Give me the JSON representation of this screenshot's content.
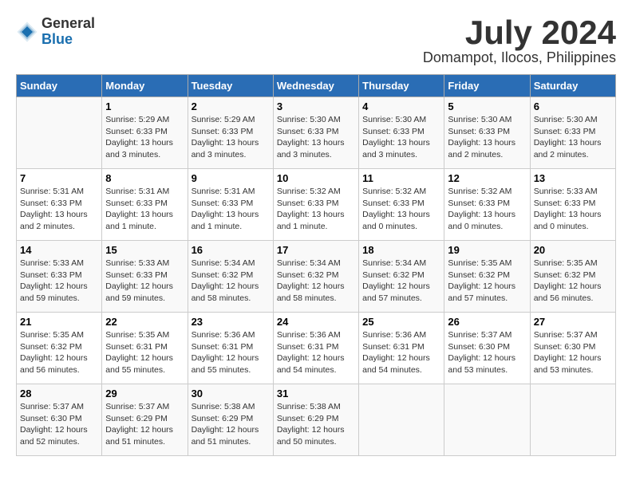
{
  "logo": {
    "general": "General",
    "blue": "Blue"
  },
  "title": "July 2024",
  "subtitle": "Domampot, Ilocos, Philippines",
  "calendar": {
    "headers": [
      "Sunday",
      "Monday",
      "Tuesday",
      "Wednesday",
      "Thursday",
      "Friday",
      "Saturday"
    ],
    "weeks": [
      [
        {
          "day": "",
          "info": ""
        },
        {
          "day": "1",
          "info": "Sunrise: 5:29 AM\nSunset: 6:33 PM\nDaylight: 13 hours\nand 3 minutes."
        },
        {
          "day": "2",
          "info": "Sunrise: 5:29 AM\nSunset: 6:33 PM\nDaylight: 13 hours\nand 3 minutes."
        },
        {
          "day": "3",
          "info": "Sunrise: 5:30 AM\nSunset: 6:33 PM\nDaylight: 13 hours\nand 3 minutes."
        },
        {
          "day": "4",
          "info": "Sunrise: 5:30 AM\nSunset: 6:33 PM\nDaylight: 13 hours\nand 3 minutes."
        },
        {
          "day": "5",
          "info": "Sunrise: 5:30 AM\nSunset: 6:33 PM\nDaylight: 13 hours\nand 2 minutes."
        },
        {
          "day": "6",
          "info": "Sunrise: 5:30 AM\nSunset: 6:33 PM\nDaylight: 13 hours\nand 2 minutes."
        }
      ],
      [
        {
          "day": "7",
          "info": "Sunrise: 5:31 AM\nSunset: 6:33 PM\nDaylight: 13 hours\nand 2 minutes."
        },
        {
          "day": "8",
          "info": "Sunrise: 5:31 AM\nSunset: 6:33 PM\nDaylight: 13 hours\nand 1 minute."
        },
        {
          "day": "9",
          "info": "Sunrise: 5:31 AM\nSunset: 6:33 PM\nDaylight: 13 hours\nand 1 minute."
        },
        {
          "day": "10",
          "info": "Sunrise: 5:32 AM\nSunset: 6:33 PM\nDaylight: 13 hours\nand 1 minute."
        },
        {
          "day": "11",
          "info": "Sunrise: 5:32 AM\nSunset: 6:33 PM\nDaylight: 13 hours\nand 0 minutes."
        },
        {
          "day": "12",
          "info": "Sunrise: 5:32 AM\nSunset: 6:33 PM\nDaylight: 13 hours\nand 0 minutes."
        },
        {
          "day": "13",
          "info": "Sunrise: 5:33 AM\nSunset: 6:33 PM\nDaylight: 13 hours\nand 0 minutes."
        }
      ],
      [
        {
          "day": "14",
          "info": "Sunrise: 5:33 AM\nSunset: 6:33 PM\nDaylight: 12 hours\nand 59 minutes."
        },
        {
          "day": "15",
          "info": "Sunrise: 5:33 AM\nSunset: 6:33 PM\nDaylight: 12 hours\nand 59 minutes."
        },
        {
          "day": "16",
          "info": "Sunrise: 5:34 AM\nSunset: 6:32 PM\nDaylight: 12 hours\nand 58 minutes."
        },
        {
          "day": "17",
          "info": "Sunrise: 5:34 AM\nSunset: 6:32 PM\nDaylight: 12 hours\nand 58 minutes."
        },
        {
          "day": "18",
          "info": "Sunrise: 5:34 AM\nSunset: 6:32 PM\nDaylight: 12 hours\nand 57 minutes."
        },
        {
          "day": "19",
          "info": "Sunrise: 5:35 AM\nSunset: 6:32 PM\nDaylight: 12 hours\nand 57 minutes."
        },
        {
          "day": "20",
          "info": "Sunrise: 5:35 AM\nSunset: 6:32 PM\nDaylight: 12 hours\nand 56 minutes."
        }
      ],
      [
        {
          "day": "21",
          "info": "Sunrise: 5:35 AM\nSunset: 6:32 PM\nDaylight: 12 hours\nand 56 minutes."
        },
        {
          "day": "22",
          "info": "Sunrise: 5:35 AM\nSunset: 6:31 PM\nDaylight: 12 hours\nand 55 minutes."
        },
        {
          "day": "23",
          "info": "Sunrise: 5:36 AM\nSunset: 6:31 PM\nDaylight: 12 hours\nand 55 minutes."
        },
        {
          "day": "24",
          "info": "Sunrise: 5:36 AM\nSunset: 6:31 PM\nDaylight: 12 hours\nand 54 minutes."
        },
        {
          "day": "25",
          "info": "Sunrise: 5:36 AM\nSunset: 6:31 PM\nDaylight: 12 hours\nand 54 minutes."
        },
        {
          "day": "26",
          "info": "Sunrise: 5:37 AM\nSunset: 6:30 PM\nDaylight: 12 hours\nand 53 minutes."
        },
        {
          "day": "27",
          "info": "Sunrise: 5:37 AM\nSunset: 6:30 PM\nDaylight: 12 hours\nand 53 minutes."
        }
      ],
      [
        {
          "day": "28",
          "info": "Sunrise: 5:37 AM\nSunset: 6:30 PM\nDaylight: 12 hours\nand 52 minutes."
        },
        {
          "day": "29",
          "info": "Sunrise: 5:37 AM\nSunset: 6:29 PM\nDaylight: 12 hours\nand 51 minutes."
        },
        {
          "day": "30",
          "info": "Sunrise: 5:38 AM\nSunset: 6:29 PM\nDaylight: 12 hours\nand 51 minutes."
        },
        {
          "day": "31",
          "info": "Sunrise: 5:38 AM\nSunset: 6:29 PM\nDaylight: 12 hours\nand 50 minutes."
        },
        {
          "day": "",
          "info": ""
        },
        {
          "day": "",
          "info": ""
        },
        {
          "day": "",
          "info": ""
        }
      ]
    ]
  }
}
